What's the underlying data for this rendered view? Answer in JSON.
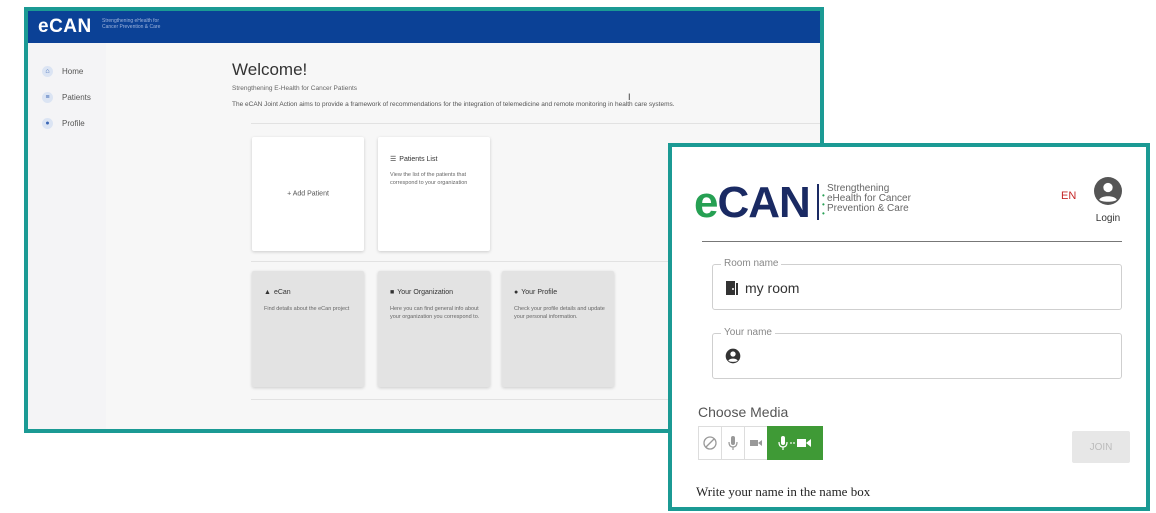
{
  "dashboard": {
    "brand": "eCAN",
    "brand_tagline": "Strengthening eHealth for Cancer Prevention & Care",
    "nav": [
      {
        "label": "Home",
        "icon": "home-icon"
      },
      {
        "label": "Patients",
        "icon": "patients-icon"
      },
      {
        "label": "Profile",
        "icon": "profile-icon"
      }
    ],
    "welcome_title": "Welcome!",
    "subtitle": "Strengthening E-Health for Cancer Patients",
    "intro": "The eCAN Joint Action aims to provide a framework of recommendations for the integration of telemedicine and remote monitoring in health care systems.",
    "cards": {
      "add_patient": "+ Add Patient",
      "patients_list_title": "Patients List",
      "patients_list_desc": "View the list of the patients that correspond to your organization",
      "ecan_title": "eCan",
      "ecan_desc": "Find details about the eCan project",
      "org_title": "Your Organization",
      "org_desc": "Here you can find general info about your organization you correspond to.",
      "profile_title": "Your Profile",
      "profile_desc": "Check your profile details and update your personal information."
    }
  },
  "login": {
    "logo_e": "e",
    "logo_rest": "CAN",
    "logo_tagline_1": "Strengthening",
    "logo_tagline_2": "eHealth for Cancer",
    "logo_tagline_3": "Prevention & Care",
    "language": "EN",
    "account_label": "Login",
    "room_label": "Room name",
    "room_value": "my room",
    "name_label": "Your name",
    "name_value": "",
    "choose_media": "Choose Media",
    "media_options": [
      "no-media",
      "audio",
      "video",
      "audio+video"
    ],
    "join_label": "JOIN",
    "hint": "Write your name in the name box",
    "colors": {
      "accent_green": "#3f9a36",
      "brand_navy": "#1a2a63",
      "frame_teal": "#1b9a94"
    }
  }
}
